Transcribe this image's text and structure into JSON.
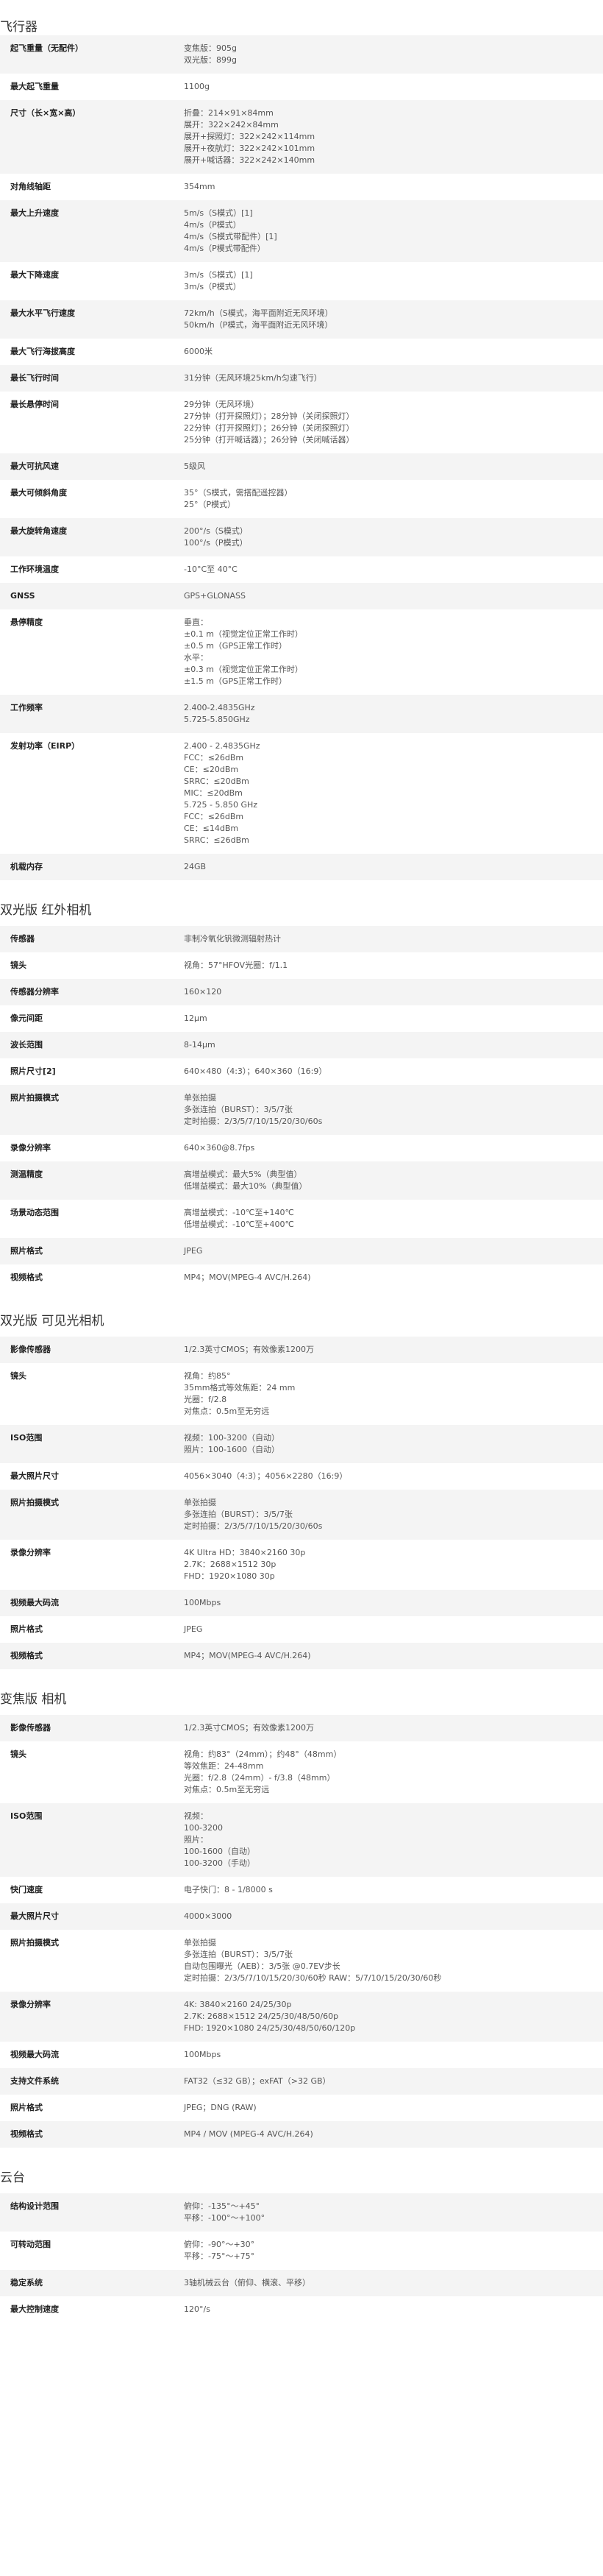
{
  "sections": [
    {
      "title": "飞行器",
      "rows": [
        {
          "label": "起飞重量（无配件）",
          "lines": [
            "变焦版：905g",
            "双光版：899g"
          ]
        },
        {
          "label": "最大起飞重量",
          "lines": [
            "1100g"
          ]
        },
        {
          "label": "尺寸（长×宽×高）",
          "lines": [
            "折叠：214×91×84mm",
            "展开：322×242×84mm",
            "展开+探照灯：322×242×114mm",
            "展开+夜航灯：322×242×101mm",
            "展开+喊话器：322×242×140mm"
          ]
        },
        {
          "label": "对角线轴距",
          "lines": [
            "354mm"
          ]
        },
        {
          "label": "最大上升速度",
          "lines": [
            "5m/s（S模式）[1]",
            "4m/s（P模式）",
            "4m/s（S模式带配件）[1]",
            "4m/s（P模式带配件）"
          ]
        },
        {
          "label": "最大下降速度",
          "lines": [
            "3m/s（S模式）[1]",
            "3m/s（P模式）"
          ]
        },
        {
          "label": "最大水平飞行速度",
          "lines": [
            "72km/h（S模式，海平面附近无风环境）",
            "50km/h（P模式，海平面附近无风环境）"
          ]
        },
        {
          "label": "最大飞行海拔高度",
          "lines": [
            "6000米"
          ]
        },
        {
          "label": "最长飞行时间",
          "lines": [
            "31分钟（无风环境25km/h匀速飞行）"
          ]
        },
        {
          "label": "最长悬停时间",
          "lines": [
            "29分钟（无风环境）",
            "27分钟（打开探照灯）；28分钟（关闭探照灯）",
            "22分钟（打开探照灯）；26分钟（关闭探照灯）",
            "25分钟（打开喊话器）；26分钟（关闭喊话器）"
          ]
        },
        {
          "label": "最大可抗风速",
          "lines": [
            "5级风"
          ]
        },
        {
          "label": "最大可倾斜角度",
          "lines": [
            "35°（S模式，需搭配遥控器）",
            "25°（P模式）"
          ]
        },
        {
          "label": "最大旋转角速度",
          "lines": [
            "200°/s（S模式）",
            "100°/s（P模式）"
          ]
        },
        {
          "label": "工作环境温度",
          "lines": [
            "-10°C至 40°C"
          ]
        },
        {
          "label": "GNSS",
          "lines": [
            "GPS+GLONASS"
          ]
        },
        {
          "label": "悬停精度",
          "lines": [
            "垂直：",
            "±0.1 m（视觉定位正常工作时）",
            "±0.5 m（GPS正常工作时）",
            "水平：",
            "±0.3 m（视觉定位正常工作时）",
            "±1.5 m（GPS正常工作时）"
          ]
        },
        {
          "label": "工作频率",
          "lines": [
            "2.400-2.4835GHz",
            "5.725-5.850GHz"
          ]
        },
        {
          "label": "发射功率（EIRP）",
          "lines": [
            "2.400 - 2.4835GHz",
            "FCC：≤26dBm",
            "CE：≤20dBm",
            "SRRC：≤20dBm",
            "MIC：≤20dBm",
            "5.725 - 5.850 GHz",
            "FCC：≤26dBm",
            "CE：≤14dBm",
            "SRRC：≤26dBm"
          ]
        },
        {
          "label": "机载内存",
          "lines": [
            "24GB"
          ]
        }
      ]
    },
    {
      "title": "双光版 红外相机",
      "rows": [
        {
          "label": "传感器",
          "lines": [
            "非制冷氧化钒微测辐射热计"
          ]
        },
        {
          "label": "镜头",
          "lines": [
            "视角：57°HFOV光圈：f/1.1"
          ]
        },
        {
          "label": "传感器分辨率",
          "lines": [
            "160×120"
          ]
        },
        {
          "label": "像元间距",
          "lines": [
            "12μm"
          ]
        },
        {
          "label": "波长范围",
          "lines": [
            "8-14μm"
          ]
        },
        {
          "label": "照片尺寸[2]",
          "lines": [
            "640×480（4:3）；640×360（16:9）"
          ]
        },
        {
          "label": "照片拍摄模式",
          "lines": [
            "单张拍摄",
            "多张连拍（BURST）：3/5/7张",
            "定时拍摄：2/3/5/7/10/15/20/30/60s"
          ]
        },
        {
          "label": "录像分辨率",
          "lines": [
            "640×360@8.7fps"
          ]
        },
        {
          "label": "测温精度",
          "lines": [
            "高增益模式：最大5%（典型值）",
            "低增益模式：最大10%（典型值）"
          ]
        },
        {
          "label": "场景动态范围",
          "lines": [
            "高增益模式：-10℃至+140℃",
            "低增益模式：-10℃至+400℃"
          ]
        },
        {
          "label": "照片格式",
          "lines": [
            "JPEG"
          ]
        },
        {
          "label": "视频格式",
          "lines": [
            "MP4；MOV(MPEG-4 AVC/H.264)"
          ]
        }
      ]
    },
    {
      "title": "双光版 可见光相机",
      "rows": [
        {
          "label": "影像传感器",
          "lines": [
            "1/2.3英寸CMOS；有效像素1200万"
          ]
        },
        {
          "label": "镜头",
          "lines": [
            "视角：约85°",
            "35mm格式等效焦距：24 mm",
            "光圈：f/2.8",
            "对焦点：0.5m至无穷远"
          ]
        },
        {
          "label": "ISO范围",
          "lines": [
            "视频：100-3200（自动）",
            "照片：100-1600（自动）"
          ]
        },
        {
          "label": "最大照片尺寸",
          "lines": [
            "4056×3040（4:3）；4056×2280（16:9）"
          ]
        },
        {
          "label": "照片拍摄模式",
          "lines": [
            "单张拍摄",
            "多张连拍（BURST）：3/5/7张",
            "定时拍摄：2/3/5/7/10/15/20/30/60s"
          ]
        },
        {
          "label": "录像分辨率",
          "lines": [
            "4K Ultra HD：3840×2160 30p",
            "2.7K：2688×1512 30p",
            "FHD：1920×1080 30p"
          ]
        },
        {
          "label": "视频最大码流",
          "lines": [
            "100Mbps"
          ]
        },
        {
          "label": "照片格式",
          "lines": [
            "JPEG"
          ]
        },
        {
          "label": "视频格式",
          "lines": [
            "MP4；MOV(MPEG-4 AVC/H.264)"
          ]
        }
      ]
    },
    {
      "title": "变焦版 相机",
      "rows": [
        {
          "label": "影像传感器",
          "lines": [
            "1/2.3英寸CMOS；有效像素1200万"
          ]
        },
        {
          "label": "镜头",
          "lines": [
            "视角：约83°（24mm）；约48°（48mm）",
            "等效焦距：24-48mm",
            "光圈：f/2.8（24mm）- f/3.8（48mm）",
            "对焦点：0.5m至无穷远"
          ]
        },
        {
          "label": "ISO范围",
          "lines": [
            "视频：",
            "100-3200",
            "照片：",
            "100-1600（自动）",
            "100-3200（手动）"
          ]
        },
        {
          "label": "快门速度",
          "lines": [
            "电子快门：8 - 1/8000 s"
          ]
        },
        {
          "label": "最大照片尺寸",
          "lines": [
            "4000×3000"
          ]
        },
        {
          "label": "照片拍摄模式",
          "lines": [
            "单张拍摄",
            "多张连拍（BURST）：3/5/7张",
            "自动包围曝光（AEB）：3/5张 @0.7EV步长",
            "定时拍摄：2/3/5/7/10/15/20/30/60秒 RAW：5/7/10/15/20/30/60秒"
          ]
        },
        {
          "label": "录像分辨率",
          "lines": [
            "4K: 3840×2160 24/25/30p",
            "2.7K: 2688×1512 24/25/30/48/50/60p",
            "FHD: 1920×1080 24/25/30/48/50/60/120p"
          ]
        },
        {
          "label": "视频最大码流",
          "lines": [
            "100Mbps"
          ]
        },
        {
          "label": "支持文件系统",
          "lines": [
            "FAT32（≤32 GB）；exFAT（>32 GB）"
          ]
        },
        {
          "label": "照片格式",
          "lines": [
            "JPEG；DNG (RAW)"
          ]
        },
        {
          "label": "视频格式",
          "lines": [
            "MP4 / MOV (MPEG-4 AVC/H.264)"
          ]
        }
      ]
    },
    {
      "title": "云台",
      "rows": [
        {
          "label": "结构设计范围",
          "lines": [
            "俯仰：-135°～+45°",
            "平移：-100°～+100°"
          ]
        },
        {
          "label": "可转动范围",
          "lines": [
            "俯仰：-90°～+30°",
            "平移：-75°～+75°"
          ]
        },
        {
          "label": "稳定系统",
          "lines": [
            "3轴机械云台（俯仰、横滚、平移）"
          ]
        },
        {
          "label": "最大控制速度",
          "lines": [
            "120°/s"
          ]
        }
      ]
    }
  ]
}
